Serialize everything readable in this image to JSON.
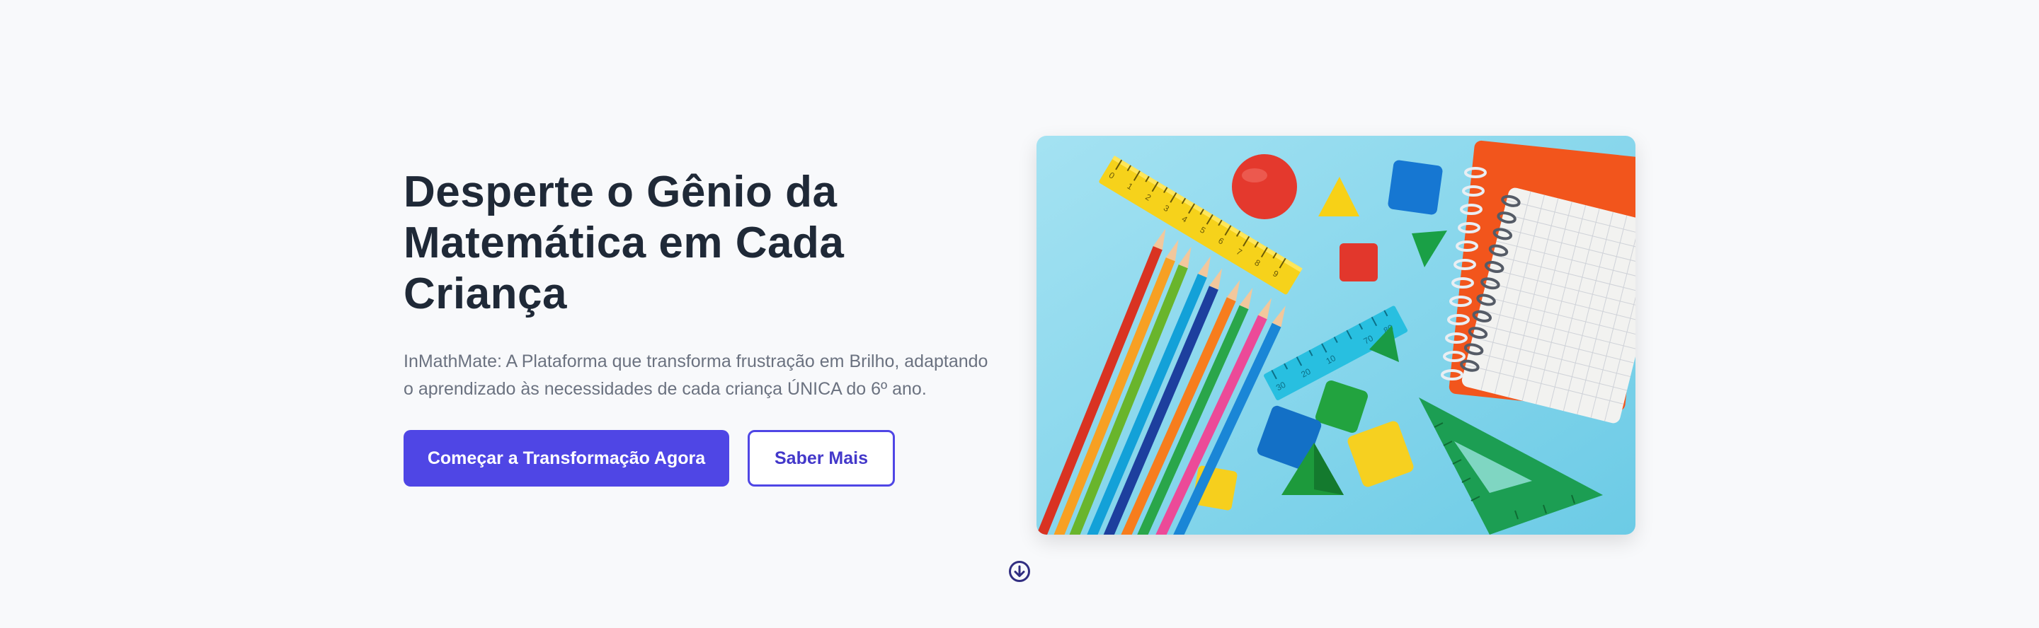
{
  "hero": {
    "title_lines": [
      "Desperte o Gênio da",
      "Matemática em Cada",
      "Criança"
    ],
    "subtitle": "InMathMate: A Plataforma que transforma frustração em Brilho, adaptando o aprendizado às necessidades de cada criança ÚNICA do 6º ano.",
    "primary_button": "Começar a Transformação Agora",
    "secondary_button": "Saber Mais"
  },
  "colors": {
    "primary": "#4f46e5",
    "heading": "#1f2937",
    "body_text": "#6b7280",
    "background": "#f8f9fb",
    "scroll_icon": "#312e81"
  },
  "image": {
    "description_icon": "math-supplies-illustration",
    "ruler_yellow_ticks": [
      "0",
      "1",
      "2",
      "3",
      "4",
      "5",
      "6",
      "7",
      "8",
      "9"
    ],
    "ruler_blue_ticks": [
      "30",
      "20",
      "10",
      "70",
      "80"
    ]
  },
  "icons": {
    "scroll": "arrow-down-circle-icon"
  }
}
